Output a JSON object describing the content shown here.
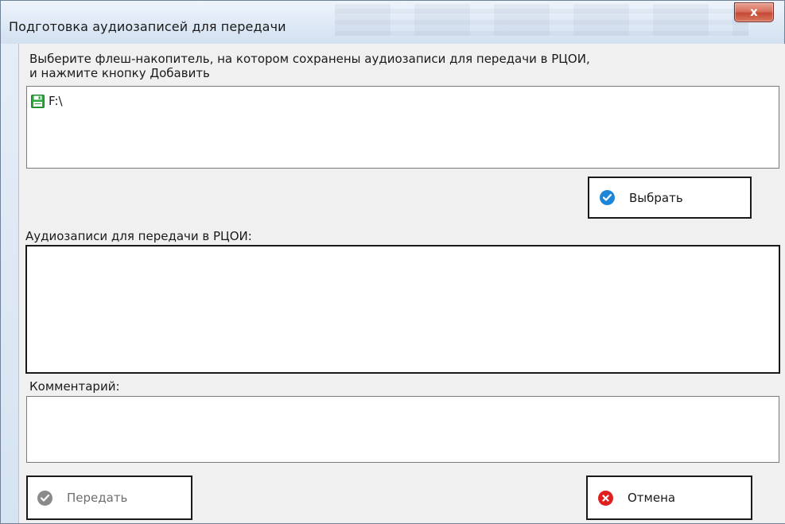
{
  "window": {
    "title": "Подготовка аудиозаписей для передачи",
    "close_label": "x"
  },
  "instruction": {
    "line1": "Выберите флеш-накопитель, на котором сохранены аудиозаписи для передачи в РЦОИ,",
    "line2": "и нажмите кнопку Добавить"
  },
  "drives": {
    "items": [
      {
        "label": "F:\\",
        "icon": "floppy-disk-icon",
        "color": "#2aa83a"
      }
    ]
  },
  "select_button": {
    "label": "Выбрать",
    "icon": "checkmark-icon",
    "color": "#1e86d8"
  },
  "records": {
    "label": "Аудиозаписи для передачи в РЦОИ:"
  },
  "comment": {
    "label": "Комментарий:",
    "value": ""
  },
  "send_button": {
    "label": "Передать",
    "icon": "checkmark-icon",
    "color": "#8a8a8a",
    "enabled": false
  },
  "cancel_button": {
    "label": "Отмена",
    "icon": "close-icon",
    "color": "#e02020"
  }
}
